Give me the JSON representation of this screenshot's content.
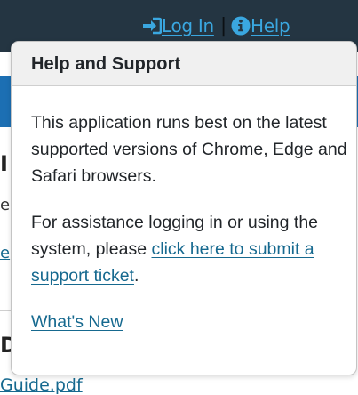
{
  "nav": {
    "login_label": " Log In",
    "separator": "|",
    "help_label": " Help",
    "link_color": "#3aa7e0",
    "bar_color": "#243542",
    "icons": [
      "sign-in-icon",
      "info-circle-icon"
    ]
  },
  "background": {
    "title_fragment": "I",
    "text_fragment": "e",
    "link_fragment": "e",
    "heading_fragment": "D",
    "file_link": "Guide.pdf",
    "band_color": "#1c6fb3"
  },
  "popover": {
    "title": "Help and Support",
    "paragraph1": "This application runs best on the latest supported versions of Chrome, Edge and Safari browsers.",
    "paragraph2_prefix": "For assistance logging in or using the system, please ",
    "support_link": "click here to submit a support ticket",
    "paragraph2_suffix": ".",
    "whats_new_link": "What's New",
    "link_color": "#16698f"
  }
}
